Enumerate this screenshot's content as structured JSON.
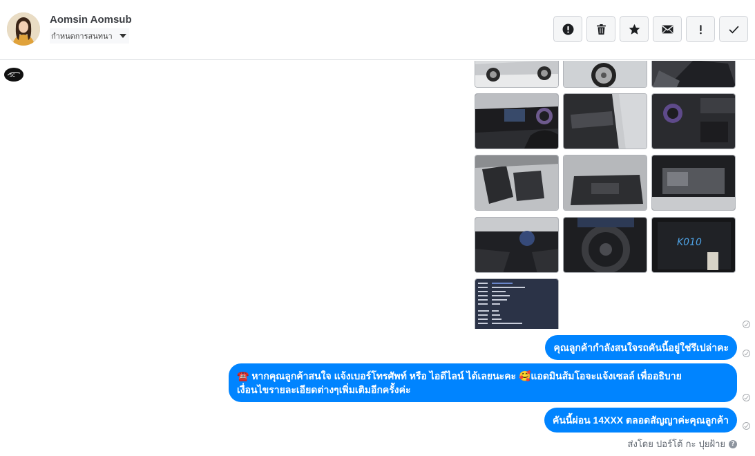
{
  "header": {
    "contact_name": "Aomsin Aomsub",
    "assign_label": "กำหนดการสนทนา"
  },
  "toolbar": {
    "buttons": [
      {
        "name": "spam",
        "icon": "alert-circle-icon"
      },
      {
        "name": "delete",
        "icon": "trash-icon"
      },
      {
        "name": "star",
        "icon": "star-icon"
      },
      {
        "name": "mark-unread",
        "icon": "envelope-icon"
      },
      {
        "name": "follow-up",
        "icon": "exclamation-icon"
      },
      {
        "name": "done",
        "icon": "check-icon"
      }
    ]
  },
  "photos": {
    "rows": 5,
    "items": [
      "car-exterior-side",
      "car-wheel",
      "car-interior-rear",
      "dashboard-left",
      "door-panel",
      "steering-closeup",
      "front-seats",
      "rear-seats",
      "engine-bay",
      "cabin-wide",
      "steering-wheel",
      "stock-tag",
      "spec-sheet"
    ],
    "stock_tag_text": "K010"
  },
  "messages": [
    {
      "text": "คุณลูกค้ากำลังสนใจรถคันนี้อยู่ใช่รึเปล่าคะ"
    },
    {
      "line1": "☎️ หากคุณลูกค้าสนใจ แจ้งเบอร์โทรศัพท์ หรือ ไอดีไลน์  ได้เลยนะคะ 🥰แอดมินส้มโอจะแจ้งเซลล์   เพื่ออธิบาย",
      "line2": "เงื่อนไขรายละเอียดต่างๆเพิ่มเติมอีกครั้งค่ะ"
    },
    {
      "text": "คันนี้ผ่อน 14XXX  ตลอดสัญญาค่ะคุณลูกค้า"
    }
  ],
  "footer": {
    "sent_by": "ส่งโดย ปอร์โต้ กะ ปุยฝ้าย",
    "help_glyph": "?"
  },
  "colors": {
    "bubble": "#0084ff",
    "border": "#dadde1"
  }
}
